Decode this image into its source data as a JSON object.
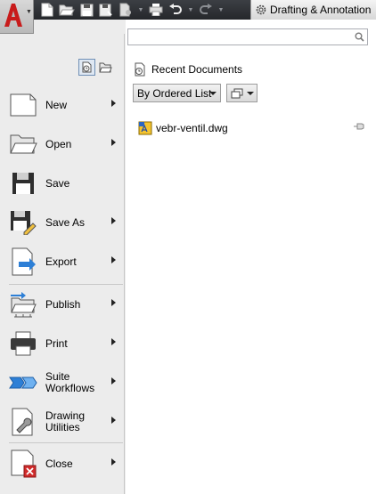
{
  "quick_access": {
    "icons": [
      "new-icon",
      "open-icon",
      "save-icon",
      "save-as-icon",
      "plot-icon",
      "print-icon",
      "undo-icon",
      "redo-icon"
    ],
    "workspace_label": "Drafting & Annotation"
  },
  "left_menu": {
    "items": [
      {
        "name": "new",
        "label": "New",
        "submenu": true
      },
      {
        "name": "open",
        "label": "Open",
        "submenu": true
      },
      {
        "name": "save",
        "label": "Save",
        "submenu": false
      },
      {
        "name": "save-as",
        "label": "Save As",
        "submenu": true
      },
      {
        "name": "export",
        "label": "Export",
        "submenu": true
      },
      {
        "name": "publish",
        "label": "Publish",
        "submenu": true
      },
      {
        "name": "print",
        "label": "Print",
        "submenu": true
      },
      {
        "name": "suite-workflows",
        "label": "Suite Workflows",
        "submenu": true
      },
      {
        "name": "drawing-utilities",
        "label": "Drawing Utilities",
        "submenu": true
      },
      {
        "name": "close",
        "label": "Close",
        "submenu": true
      }
    ]
  },
  "right_panel": {
    "search": {
      "value": "",
      "placeholder": ""
    },
    "section_title": "Recent Documents",
    "order_dropdown": "By Ordered List",
    "documents": [
      {
        "name": "vebr-ventil.dwg"
      }
    ]
  },
  "colors": {
    "accent": "#c81b1b",
    "titlebar": "#2e3035",
    "panel": "#ececec",
    "selection_border": "#6f8fb5"
  }
}
